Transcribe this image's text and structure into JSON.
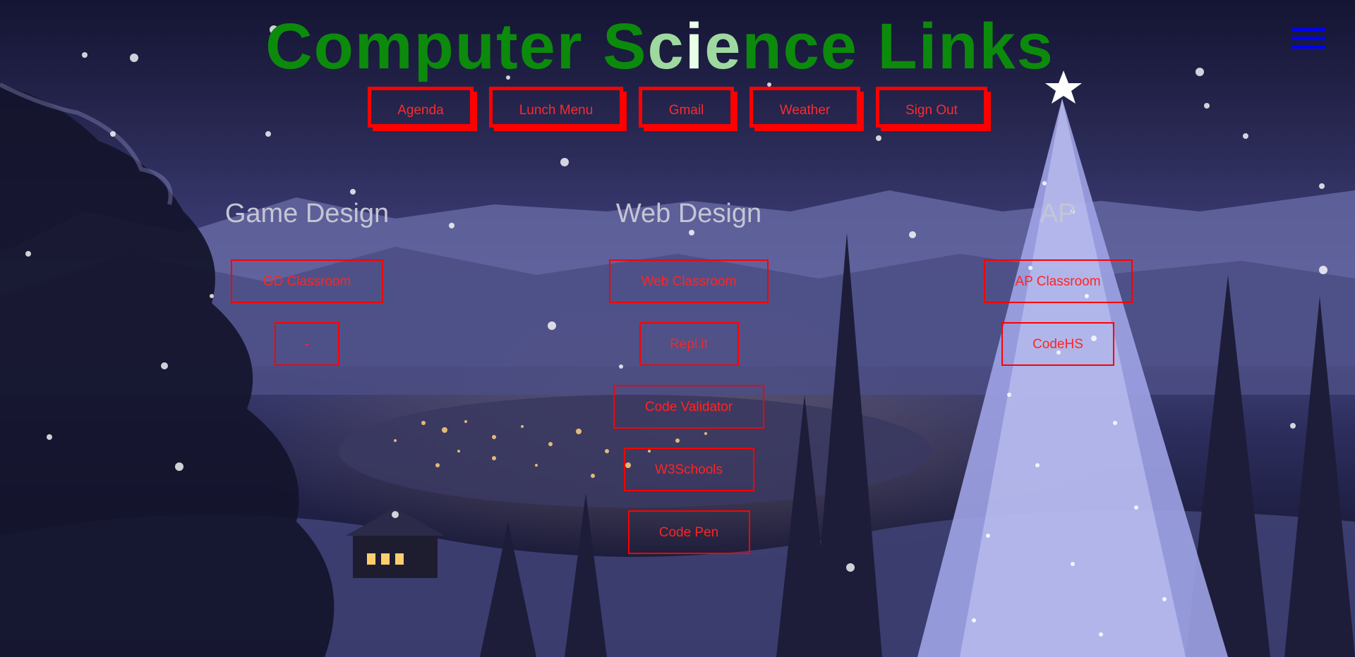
{
  "page": {
    "title_parts": [
      "Computer ",
      "S",
      "c",
      "i",
      "e",
      "nce Links"
    ]
  },
  "menu": {
    "icon": "hamburger-menu-icon"
  },
  "top_nav": [
    {
      "label": "Agenda"
    },
    {
      "label": "Lunch Menu"
    },
    {
      "label": "Gmail"
    },
    {
      "label": "Weather"
    },
    {
      "label": "Sign Out"
    }
  ],
  "columns": [
    {
      "heading": "Game Design",
      "links": [
        {
          "label": "GD Classroom"
        },
        {
          "label": "-"
        }
      ]
    },
    {
      "heading": "Web Design",
      "links": [
        {
          "label": "Web Classroom"
        },
        {
          "label": "Repl.it"
        },
        {
          "label": "Code Validator"
        },
        {
          "label": "W3Schools"
        },
        {
          "label": "Code Pen"
        }
      ]
    },
    {
      "heading": "AP",
      "links": [
        {
          "label": "AP Classroom"
        },
        {
          "label": "CodeHS"
        }
      ]
    }
  ],
  "colors": {
    "title_green": "#0c8a0c",
    "button_red": "#ff0000",
    "menu_blue": "#0000ff",
    "heading_gray": "#c5c5d4"
  }
}
